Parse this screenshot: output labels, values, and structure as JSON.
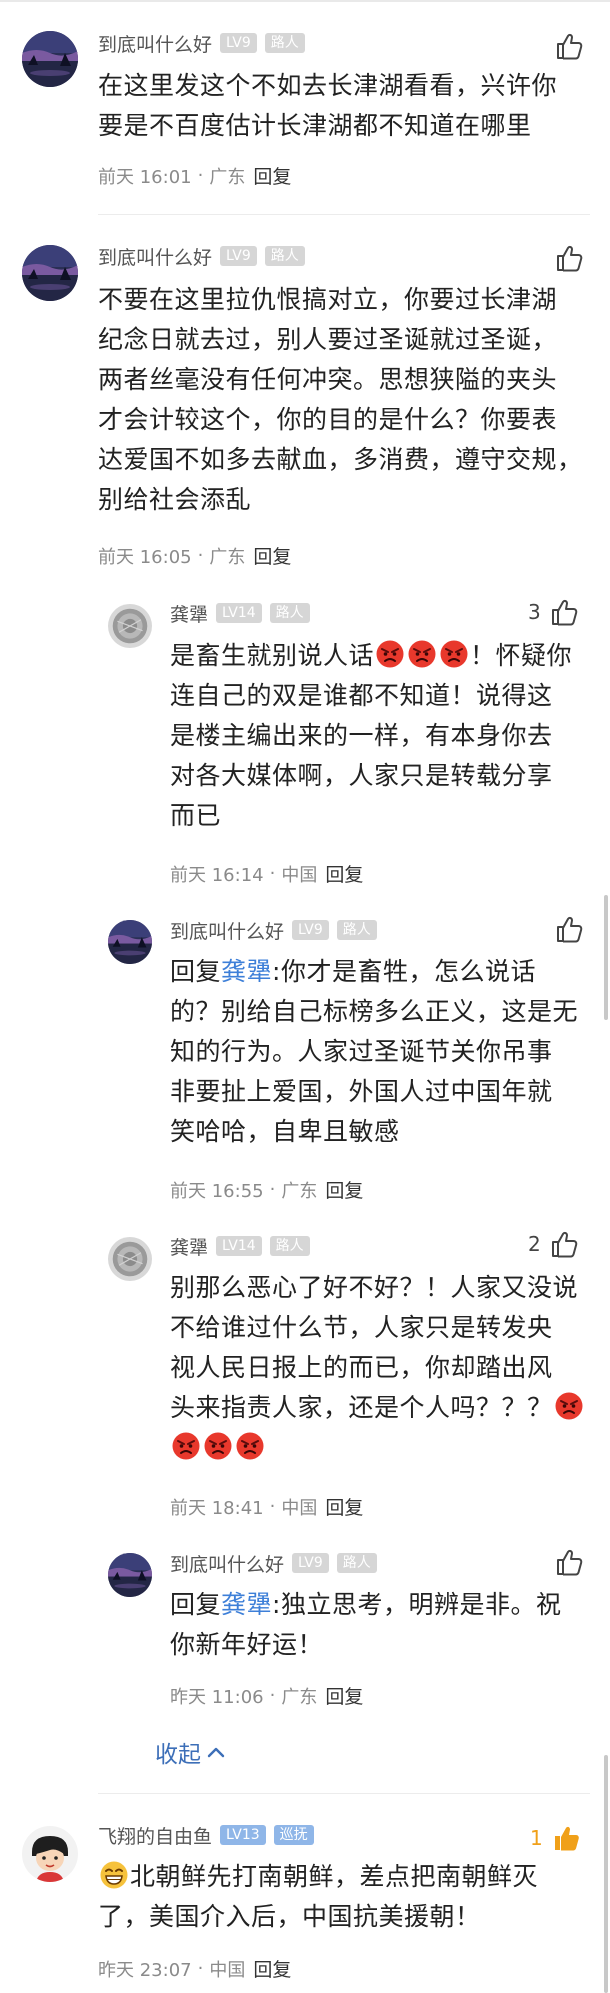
{
  "comments": [
    {
      "username": "到底叫什么好",
      "level": "LV9",
      "role": "路人",
      "text": "在这里发这个不如去长津湖看看，兴许你\n要是不百度估计长津湖都不知道在哪里",
      "time": "前天 16:01",
      "location": "广东",
      "reply": "回复",
      "likes": ""
    },
    {
      "username": "到底叫什么好",
      "level": "LV9",
      "role": "路人",
      "text": "不要在这里拉仇恨搞对立，你要过长津湖\n纪念日就去过，别人要过圣诞就过圣诞，\n两者丝毫没有任何冲突。思想狭隘的夹头\n才会计较这个，你的目的是什么？你要表\n达爱国不如多去献血，多消费，遵守交规，\n别给社会添乱",
      "time": "前天 16:05",
      "location": "广东",
      "reply": "回复",
      "likes": ""
    },
    {
      "username": "龚犟",
      "level": "LV14",
      "role": "路人",
      "text_a": "是畜生就别说人话",
      "text_b": "！怀疑你\n连自己的双是谁都不知道！说得这\n是楼主编出来的一样，有本身你去\n对各大媒体啊，人家只是转载分享\n而已",
      "time": "前天 16:14",
      "location": "中国",
      "reply": "回复",
      "likes": "3"
    },
    {
      "username": "到底叫什么好",
      "level": "LV9",
      "role": "路人",
      "reply_prefix": "回复",
      "mention": "龚犟",
      "text": ":你才是畜牲，怎么说话\n的？别给自己标榜多么正义，这是无\n知的行为。人家过圣诞节关你吊事\n非要扯上爱国，外国人过中国年就\n笑哈哈，自卑且敏感",
      "time": "前天 16:55",
      "location": "广东",
      "reply": "回复",
      "likes": ""
    },
    {
      "username": "龚犟",
      "level": "LV14",
      "role": "路人",
      "text": "别那么恶心了好不好？！人家又没说\n不给谁过什么节，人家只是转发央\n视人民日报上的而已，你却踏出风\n头来指责人家，还是个人吗？？？",
      "time": "前天 18:41",
      "location": "中国",
      "reply": "回复",
      "likes": "2"
    },
    {
      "username": "到底叫什么好",
      "level": "LV9",
      "role": "路人",
      "reply_prefix": "回复",
      "mention": "龚犟",
      "text": ":独立思考，明辨是非。祝\n你新年好运！",
      "time": "昨天 11:06",
      "location": "广东",
      "reply": "回复",
      "likes": ""
    },
    {
      "username": "飞翔的自由鱼",
      "level": "LV13",
      "role": "巡抚",
      "text": "北朝鲜先打南朝鲜，差点把南朝鲜灭\n了，美国介入后，中国抗美援朝！",
      "time": "昨天 23:07",
      "location": "中国",
      "reply": "回复",
      "likes": "1"
    }
  ],
  "collapse_label": "收起",
  "separator": "·",
  "icons": {
    "like": "thumbs-up-icon",
    "like_active": "thumbs-up-filled-icon",
    "angry": "angry-face-emoji",
    "grin": "grinning-emoji",
    "collapse": "chevron-up-icon"
  },
  "colors": {
    "mention": "#3d7fd8",
    "collapse": "#3d6fb8",
    "like_active": "#f0a019",
    "badge": "#d6d6d6",
    "badge_blue": "#8fb6e8"
  }
}
